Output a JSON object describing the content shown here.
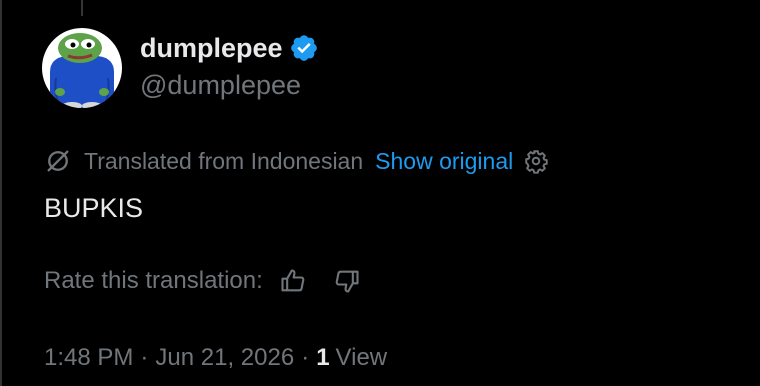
{
  "author": {
    "display_name": "dumplepee",
    "handle": "@dumplepee",
    "verified": true,
    "verified_color": "#1d9bf0"
  },
  "translation": {
    "icon": "translate-icon",
    "label": "Translated from Indonesian",
    "show_original": "Show original",
    "settings_icon": "gear-icon"
  },
  "tweet": {
    "text": "BUPKIS"
  },
  "rating": {
    "label": "Rate this translation:",
    "thumbs_up_icon": "thumbs-up-icon",
    "thumbs_down_icon": "thumbs-down-icon"
  },
  "meta": {
    "time": "1:48 PM",
    "separator": "·",
    "date": "Jun 21, 2026",
    "views_count": "1",
    "views_label": "View"
  },
  "colors": {
    "background": "#000000",
    "primary_text": "#e7e9ea",
    "secondary_text": "#71767b",
    "link": "#1d9bf0"
  }
}
